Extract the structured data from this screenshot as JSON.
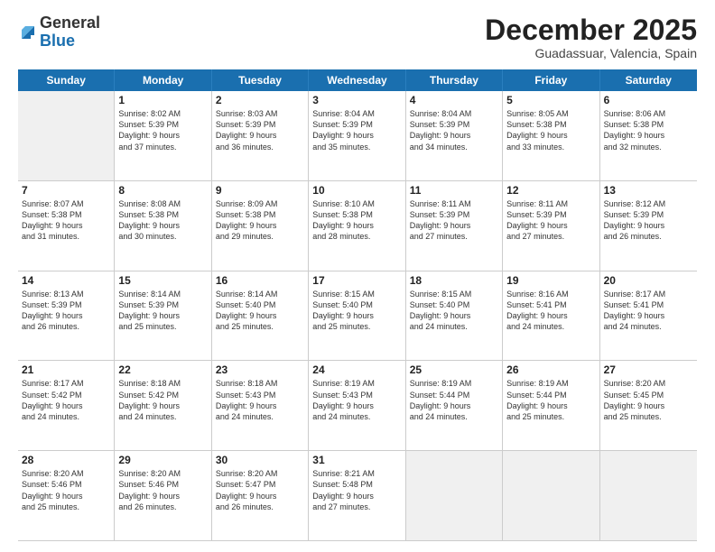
{
  "header": {
    "logo_general": "General",
    "logo_blue": "Blue",
    "month_title": "December 2025",
    "location": "Guadassuar, Valencia, Spain"
  },
  "days_of_week": [
    "Sunday",
    "Monday",
    "Tuesday",
    "Wednesday",
    "Thursday",
    "Friday",
    "Saturday"
  ],
  "weeks": [
    [
      {
        "day": "",
        "text": "",
        "shaded": true
      },
      {
        "day": "1",
        "text": "Sunrise: 8:02 AM\nSunset: 5:39 PM\nDaylight: 9 hours\nand 37 minutes."
      },
      {
        "day": "2",
        "text": "Sunrise: 8:03 AM\nSunset: 5:39 PM\nDaylight: 9 hours\nand 36 minutes."
      },
      {
        "day": "3",
        "text": "Sunrise: 8:04 AM\nSunset: 5:39 PM\nDaylight: 9 hours\nand 35 minutes."
      },
      {
        "day": "4",
        "text": "Sunrise: 8:04 AM\nSunset: 5:39 PM\nDaylight: 9 hours\nand 34 minutes."
      },
      {
        "day": "5",
        "text": "Sunrise: 8:05 AM\nSunset: 5:38 PM\nDaylight: 9 hours\nand 33 minutes."
      },
      {
        "day": "6",
        "text": "Sunrise: 8:06 AM\nSunset: 5:38 PM\nDaylight: 9 hours\nand 32 minutes."
      }
    ],
    [
      {
        "day": "7",
        "text": "Sunrise: 8:07 AM\nSunset: 5:38 PM\nDaylight: 9 hours\nand 31 minutes."
      },
      {
        "day": "8",
        "text": "Sunrise: 8:08 AM\nSunset: 5:38 PM\nDaylight: 9 hours\nand 30 minutes."
      },
      {
        "day": "9",
        "text": "Sunrise: 8:09 AM\nSunset: 5:38 PM\nDaylight: 9 hours\nand 29 minutes."
      },
      {
        "day": "10",
        "text": "Sunrise: 8:10 AM\nSunset: 5:38 PM\nDaylight: 9 hours\nand 28 minutes."
      },
      {
        "day": "11",
        "text": "Sunrise: 8:11 AM\nSunset: 5:39 PM\nDaylight: 9 hours\nand 27 minutes."
      },
      {
        "day": "12",
        "text": "Sunrise: 8:11 AM\nSunset: 5:39 PM\nDaylight: 9 hours\nand 27 minutes."
      },
      {
        "day": "13",
        "text": "Sunrise: 8:12 AM\nSunset: 5:39 PM\nDaylight: 9 hours\nand 26 minutes."
      }
    ],
    [
      {
        "day": "14",
        "text": "Sunrise: 8:13 AM\nSunset: 5:39 PM\nDaylight: 9 hours\nand 26 minutes."
      },
      {
        "day": "15",
        "text": "Sunrise: 8:14 AM\nSunset: 5:39 PM\nDaylight: 9 hours\nand 25 minutes."
      },
      {
        "day": "16",
        "text": "Sunrise: 8:14 AM\nSunset: 5:40 PM\nDaylight: 9 hours\nand 25 minutes."
      },
      {
        "day": "17",
        "text": "Sunrise: 8:15 AM\nSunset: 5:40 PM\nDaylight: 9 hours\nand 25 minutes."
      },
      {
        "day": "18",
        "text": "Sunrise: 8:15 AM\nSunset: 5:40 PM\nDaylight: 9 hours\nand 24 minutes."
      },
      {
        "day": "19",
        "text": "Sunrise: 8:16 AM\nSunset: 5:41 PM\nDaylight: 9 hours\nand 24 minutes."
      },
      {
        "day": "20",
        "text": "Sunrise: 8:17 AM\nSunset: 5:41 PM\nDaylight: 9 hours\nand 24 minutes."
      }
    ],
    [
      {
        "day": "21",
        "text": "Sunrise: 8:17 AM\nSunset: 5:42 PM\nDaylight: 9 hours\nand 24 minutes."
      },
      {
        "day": "22",
        "text": "Sunrise: 8:18 AM\nSunset: 5:42 PM\nDaylight: 9 hours\nand 24 minutes."
      },
      {
        "day": "23",
        "text": "Sunrise: 8:18 AM\nSunset: 5:43 PM\nDaylight: 9 hours\nand 24 minutes."
      },
      {
        "day": "24",
        "text": "Sunrise: 8:19 AM\nSunset: 5:43 PM\nDaylight: 9 hours\nand 24 minutes."
      },
      {
        "day": "25",
        "text": "Sunrise: 8:19 AM\nSunset: 5:44 PM\nDaylight: 9 hours\nand 24 minutes."
      },
      {
        "day": "26",
        "text": "Sunrise: 8:19 AM\nSunset: 5:44 PM\nDaylight: 9 hours\nand 25 minutes."
      },
      {
        "day": "27",
        "text": "Sunrise: 8:20 AM\nSunset: 5:45 PM\nDaylight: 9 hours\nand 25 minutes."
      }
    ],
    [
      {
        "day": "28",
        "text": "Sunrise: 8:20 AM\nSunset: 5:46 PM\nDaylight: 9 hours\nand 25 minutes."
      },
      {
        "day": "29",
        "text": "Sunrise: 8:20 AM\nSunset: 5:46 PM\nDaylight: 9 hours\nand 26 minutes."
      },
      {
        "day": "30",
        "text": "Sunrise: 8:20 AM\nSunset: 5:47 PM\nDaylight: 9 hours\nand 26 minutes."
      },
      {
        "day": "31",
        "text": "Sunrise: 8:21 AM\nSunset: 5:48 PM\nDaylight: 9 hours\nand 27 minutes."
      },
      {
        "day": "",
        "text": "",
        "shaded": true
      },
      {
        "day": "",
        "text": "",
        "shaded": true
      },
      {
        "day": "",
        "text": "",
        "shaded": true
      }
    ]
  ]
}
